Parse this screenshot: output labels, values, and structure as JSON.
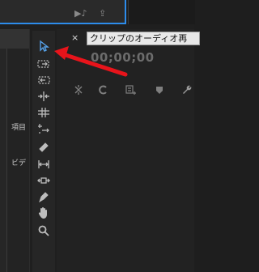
{
  "monitor_controls": {
    "audio_glyph": "▶♪",
    "export_glyph": "⇪"
  },
  "project_panel": {
    "items_label": "項目",
    "video_label": "ビデ"
  },
  "tools": [
    {
      "name": "selection-tool",
      "icon": "selection-arrow"
    },
    {
      "name": "track-select-forward-tool",
      "icon": "track-select-forward"
    },
    {
      "name": "track-select-backward-tool",
      "icon": "track-select-backward"
    },
    {
      "name": "ripple-edit-tool",
      "icon": "ripple-edit"
    },
    {
      "name": "rolling-edit-tool",
      "icon": "rolling-edit"
    },
    {
      "name": "rate-stretch-tool",
      "icon": "rate-stretch"
    },
    {
      "name": "razor-tool",
      "icon": "razor"
    },
    {
      "name": "slip-tool",
      "icon": "slip"
    },
    {
      "name": "slide-tool",
      "icon": "slide"
    },
    {
      "name": "pen-tool",
      "icon": "pen"
    },
    {
      "name": "hand-tool",
      "icon": "hand"
    },
    {
      "name": "zoom-tool",
      "icon": "zoom"
    }
  ],
  "timeline": {
    "close_label": "×",
    "tooltip": "クリップのオーディオ再",
    "timecode": "00;00;00",
    "toolbar_icons": [
      "snap-icon",
      "linked-selection-icon",
      "add-marker-icon",
      "marker-icon",
      "wrench-icon"
    ]
  },
  "annotation": {
    "arrow_color": "#e8141b"
  }
}
